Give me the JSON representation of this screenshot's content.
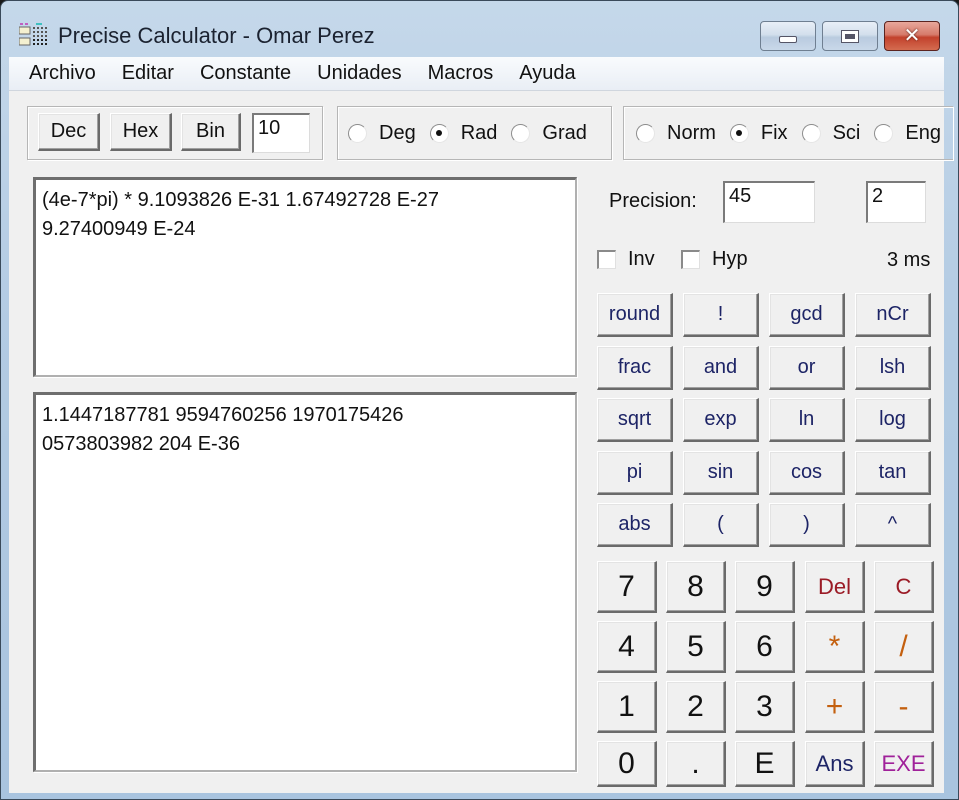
{
  "window": {
    "title": "Precise Calculator - Omar Perez",
    "icons": {
      "app": "calculator-grid-icon",
      "minimize": "minimize-icon",
      "maximize": "maximize-icon",
      "close": "close-icon"
    }
  },
  "menu": [
    "Archivo",
    "Editar",
    "Constante",
    "Unidades",
    "Macros",
    "Ayuda"
  ],
  "base_group": {
    "buttons": [
      "Dec",
      "Hex",
      "Bin"
    ],
    "base_value": "10"
  },
  "angle_group": {
    "options": [
      {
        "label": "Deg",
        "selected": false
      },
      {
        "label": "Rad",
        "selected": true
      },
      {
        "label": "Grad",
        "selected": false
      }
    ]
  },
  "format_group": {
    "options": [
      {
        "label": "Norm",
        "selected": false
      },
      {
        "label": "Fix",
        "selected": true
      },
      {
        "label": "Sci",
        "selected": false
      },
      {
        "label": "Eng",
        "selected": false
      }
    ]
  },
  "expression": "(4e-7*pi) * 9.1093826 E-31 1.67492728 E-27\n9.27400949 E-24",
  "result": "1.1447187781 9594760256 1970175426\n0573803982 204 E-36",
  "precision": {
    "label": "Precision:",
    "digits": "45",
    "fix_digits": "2"
  },
  "options": {
    "inv": {
      "label": "Inv",
      "checked": false
    },
    "hyp": {
      "label": "Hyp",
      "checked": false
    },
    "timing": "3 ms"
  },
  "function_keys": [
    [
      "round",
      "!",
      "gcd",
      "nCr"
    ],
    [
      "frac",
      "and",
      "or",
      "lsh"
    ],
    [
      "sqrt",
      "exp",
      "ln",
      "log"
    ],
    [
      "pi",
      "sin",
      "cos",
      "tan"
    ],
    [
      "abs",
      "(",
      ")",
      "^"
    ]
  ],
  "number_keys": [
    [
      "7",
      "8",
      "9",
      "Del",
      "C"
    ],
    [
      "4",
      "5",
      "6",
      "*",
      "/"
    ],
    [
      "1",
      "2",
      "3",
      "+",
      "-"
    ],
    [
      "0",
      ".",
      "E",
      "Ans",
      "EXE"
    ]
  ],
  "key_colors": {
    "Del": "#9b1b26",
    "C": "#9b1b26",
    "*": "#c4600f",
    "/": "#c4600f",
    "+": "#c4600f",
    "-": "#c4600f",
    "Ans": "#1d2466",
    "EXE": "#a0219a"
  }
}
